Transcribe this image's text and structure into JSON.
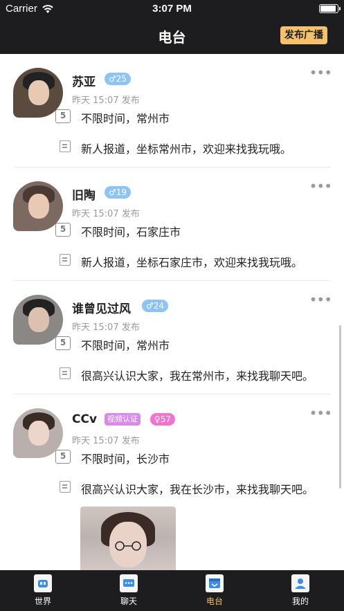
{
  "status_bar": {
    "carrier": "Carrier",
    "time": "3:07 PM"
  },
  "header": {
    "title": "电台",
    "publish_label": "发布广播"
  },
  "posts": [
    {
      "name": "苏亚",
      "gender_badge": "♂25",
      "meta": "昨天 15:07 发布",
      "calendar_glyph": "5",
      "location": "不限时间，常州市",
      "message": "新人报道，坐标常州市，欢迎来找我玩哦。",
      "more": "•••"
    },
    {
      "name": "旧陶",
      "gender_badge": "♂19",
      "meta": "昨天 15:07 发布",
      "calendar_glyph": "5",
      "location": "不限时间，石家庄市",
      "message": "新人报道，坐标石家庄市，欢迎来找我玩哦。",
      "more": "•••"
    },
    {
      "name": "谁曾见过风",
      "gender_badge": "♂24",
      "meta": "昨天 15:07 发布",
      "calendar_glyph": "5",
      "location": "不限时间，常州市",
      "message": "很高兴认识大家，我在常州市，来找我聊天吧。",
      "more": "•••"
    },
    {
      "name": "CCv",
      "video_badge": "视频认证",
      "gender_badge": "♀57",
      "meta": "昨天 15:07 发布",
      "calendar_glyph": "5",
      "location": "不限时间，长沙市",
      "message": "很高兴认识大家，我在长沙市，来找我聊天吧。",
      "more": "•••"
    }
  ],
  "tabbar": {
    "tabs": [
      {
        "label": "世界",
        "icon": "world-icon",
        "active": false
      },
      {
        "label": "聊天",
        "icon": "chat-icon",
        "active": false
      },
      {
        "label": "电台",
        "icon": "radio-icon",
        "active": true
      },
      {
        "label": "我的",
        "icon": "profile-icon",
        "active": false
      }
    ]
  },
  "colors": {
    "bar_bg": "#1d1d1f",
    "accent": "#f5c26b",
    "male_badge": "#8dc4f3",
    "female_badge": "#ef74cf",
    "video_badge": "#d88be7"
  }
}
